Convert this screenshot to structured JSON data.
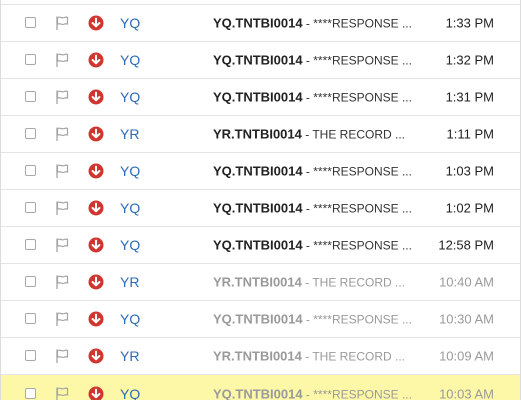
{
  "colors": {
    "sender": "#2b6cb8",
    "priority": "#d0362f",
    "highlight": "#fdf8a8",
    "read_text": "#9a9a9a",
    "unread_text": "#222222"
  },
  "icons": {
    "flag": "flag-icon",
    "priority": "arrow-down-circle-icon",
    "checkbox": "checkbox"
  },
  "messages": [
    {
      "sender": "YQ",
      "code": "YQ.TNTBI0014",
      "subject": " - ****RESPONSE ...",
      "time": "1:33 PM",
      "read": false
    },
    {
      "sender": "YQ",
      "code": "YQ.TNTBI0014",
      "subject": " - ****RESPONSE ...",
      "time": "1:32 PM",
      "read": false
    },
    {
      "sender": "YQ",
      "code": "YQ.TNTBI0014",
      "subject": " - ****RESPONSE ...",
      "time": "1:31 PM",
      "read": false
    },
    {
      "sender": "YR",
      "code": "YR.TNTBI0014",
      "subject": " - THE RECORD ...",
      "time": "1:11 PM",
      "read": false
    },
    {
      "sender": "YQ",
      "code": "YQ.TNTBI0014",
      "subject": " - ****RESPONSE ...",
      "time": "1:03 PM",
      "read": false
    },
    {
      "sender": "YQ",
      "code": "YQ.TNTBI0014",
      "subject": " - ****RESPONSE ...",
      "time": "1:02 PM",
      "read": false
    },
    {
      "sender": "YQ",
      "code": "YQ.TNTBI0014",
      "subject": " - ****RESPONSE ...",
      "time": "12:58 PM",
      "read": false
    },
    {
      "sender": "YR",
      "code": "YR.TNTBI0014",
      "subject": " - THE RECORD ...",
      "time": "10:40 AM",
      "read": true
    },
    {
      "sender": "YQ",
      "code": "YQ.TNTBI0014",
      "subject": " - ****RESPONSE ...",
      "time": "10:30 AM",
      "read": true
    },
    {
      "sender": "YR",
      "code": "YR.TNTBI0014",
      "subject": " - THE RECORD ...",
      "time": "10:09 AM",
      "read": true
    },
    {
      "sender": "YQ",
      "code": "YQ.TNTBI0014",
      "subject": " - ****RESPONSE ...",
      "time": "10:03 AM",
      "read": true,
      "highlighted": true
    }
  ]
}
